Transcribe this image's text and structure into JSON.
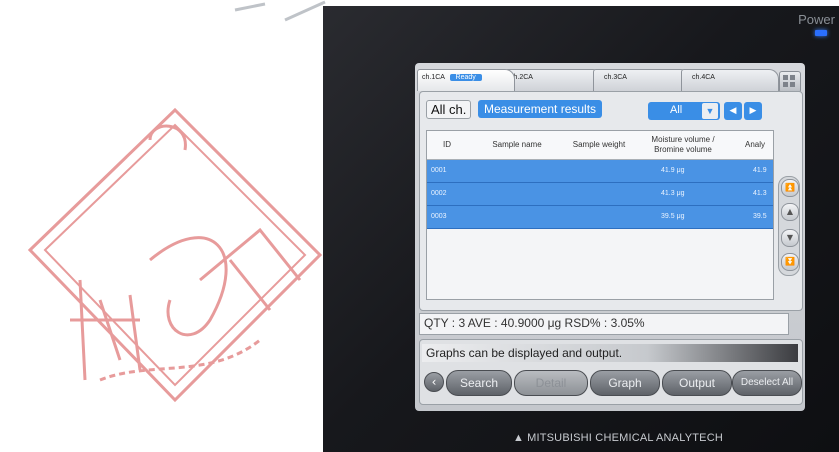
{
  "seal": {
    "text": "德用"
  },
  "device": {
    "power_label": "Power",
    "brand": "MITSUBISHI CHEMICAL ANALYTECH",
    "brand_icon": "mitsubishi-logo-icon"
  },
  "tabs": [
    {
      "label": "ch.1CA",
      "status": "Ready"
    },
    {
      "label": "ch.2CA"
    },
    {
      "label": "ch.3CA"
    },
    {
      "label": "ch.4CA"
    }
  ],
  "panel": {
    "all_ch": "All ch.",
    "title": "Measurement results",
    "filter_value": "All",
    "filter_icon": "dropdown-triangle-icon",
    "prev_icon": "chevron-left-icon",
    "next_icon": "chevron-right-icon"
  },
  "table": {
    "headers": [
      "ID",
      "Sample name",
      "Sample weight",
      "Moisture volume /\nBromine volume",
      "Analy"
    ],
    "rows": [
      {
        "id": "0001",
        "name": "",
        "weight": "",
        "volume": "41.9 μg",
        "analy": "41.9"
      },
      {
        "id": "0002",
        "name": "",
        "weight": "",
        "volume": "41.3 μg",
        "analy": "41.3"
      },
      {
        "id": "0003",
        "name": "",
        "weight": "",
        "volume": "39.5 μg",
        "analy": "39.5"
      }
    ]
  },
  "summary": "QTY : 3   AVE : 40.9000 μg   RSD% : 3.05%",
  "message": "Graphs can be displayed and output.",
  "buttons": {
    "search": "Search",
    "detail": "Detail",
    "graph": "Graph",
    "output": "Output",
    "deselect_all": "Deselect All"
  },
  "colors": {
    "accent": "#3a8ee6",
    "row_selected": "#4a93e4",
    "power_led": "#2a6fff",
    "seal": "#e07a7a"
  }
}
